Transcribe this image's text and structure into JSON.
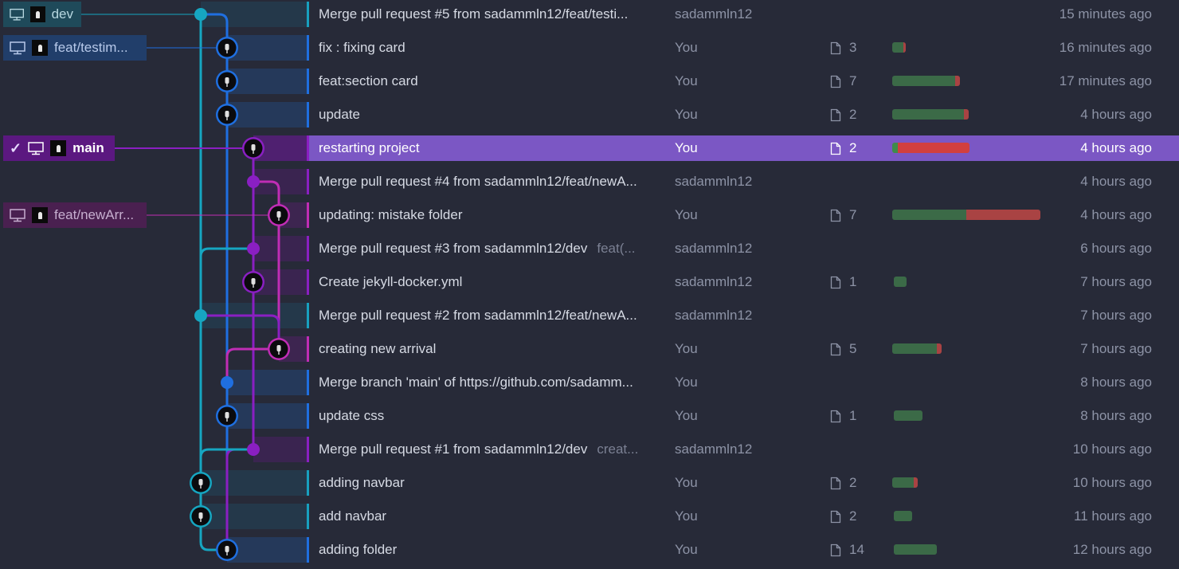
{
  "colors": {
    "dev": "#16a6c1",
    "testimonial": "#1f6fe0",
    "main": "#8a1fc2",
    "newArrival": "#c02db5",
    "selected_row": "#7b57c4",
    "additions": "#3b6a47",
    "deletions": "#a94343"
  },
  "icons": {
    "branch_label": "monitor-icon",
    "avatar": "avatar-icon",
    "files": "file-icon",
    "current": "check-icon"
  },
  "branches": [
    {
      "name": "dev",
      "current": false
    },
    {
      "name": "feat/testim...",
      "current": false
    },
    {
      "name": "main",
      "current": true
    },
    {
      "name": "feat/newArr...",
      "current": false
    }
  ],
  "commits": [
    {
      "message": "Merge pull request #5 from sadammln12/feat/testi...",
      "sub": "",
      "author": "sadammln12",
      "files": "",
      "additions": 0,
      "deletions": 0,
      "date": "15 minutes ago"
    },
    {
      "message": "fix : fixing card",
      "sub": "",
      "author": "You",
      "files": "3",
      "additions": 12,
      "deletions": 3,
      "date": "16 minutes ago"
    },
    {
      "message": "feat:section card",
      "sub": "",
      "author": "You",
      "files": "7",
      "additions": 70,
      "deletions": 5,
      "date": "17 minutes ago"
    },
    {
      "message": "update",
      "sub": "",
      "author": "You",
      "files": "2",
      "additions": 80,
      "deletions": 5,
      "date": "4 hours ago"
    },
    {
      "message": "restarting project",
      "sub": "",
      "author": "You",
      "files": "2",
      "additions": 6,
      "deletions": 80,
      "date": "4 hours ago"
    },
    {
      "message": "Merge pull request #4 from sadammln12/feat/newA...",
      "sub": "",
      "author": "sadammln12",
      "files": "",
      "additions": 0,
      "deletions": 0,
      "date": "4 hours ago"
    },
    {
      "message": "updating: mistake folder",
      "sub": "",
      "author": "You",
      "files": "7",
      "additions": 82,
      "deletions": 82,
      "date": "4 hours ago"
    },
    {
      "message": "Merge pull request #3 from sadammln12/dev",
      "sub": "feat(...",
      "author": "sadammln12",
      "files": "",
      "additions": 0,
      "deletions": 0,
      "date": "6 hours ago"
    },
    {
      "message": "Create jekyll-docker.yml",
      "sub": "",
      "author": "sadammln12",
      "files": "1",
      "additions": 14,
      "deletions": 0,
      "date": "7 hours ago"
    },
    {
      "message": "Merge pull request #2 from sadammln12/feat/newA...",
      "sub": "",
      "author": "sadammln12",
      "files": "",
      "additions": 0,
      "deletions": 0,
      "date": "7 hours ago"
    },
    {
      "message": "creating new arrival",
      "sub": "",
      "author": "You",
      "files": "5",
      "additions": 50,
      "deletions": 5,
      "date": "7 hours ago"
    },
    {
      "message": "Merge branch 'main' of https://github.com/sadamm...",
      "sub": "",
      "author": "You",
      "files": "",
      "additions": 0,
      "deletions": 0,
      "date": "8 hours ago"
    },
    {
      "message": "update css",
      "sub": "",
      "author": "You",
      "files": "1",
      "additions": 32,
      "deletions": 0,
      "date": "8 hours ago"
    },
    {
      "message": "Merge pull request #1 from sadammln12/dev",
      "sub": "creat...",
      "author": "sadammln12",
      "files": "",
      "additions": 0,
      "deletions": 0,
      "date": "10 hours ago"
    },
    {
      "message": "adding navbar",
      "sub": "",
      "author": "You",
      "files": "2",
      "additions": 24,
      "deletions": 4,
      "date": "10 hours ago"
    },
    {
      "message": "add navbar",
      "sub": "",
      "author": "You",
      "files": "2",
      "additions": 20,
      "deletions": 0,
      "date": "11 hours ago"
    },
    {
      "message": "adding folder",
      "sub": "",
      "author": "You",
      "files": "14",
      "additions": 48,
      "deletions": 0,
      "date": "12 hours ago"
    }
  ]
}
